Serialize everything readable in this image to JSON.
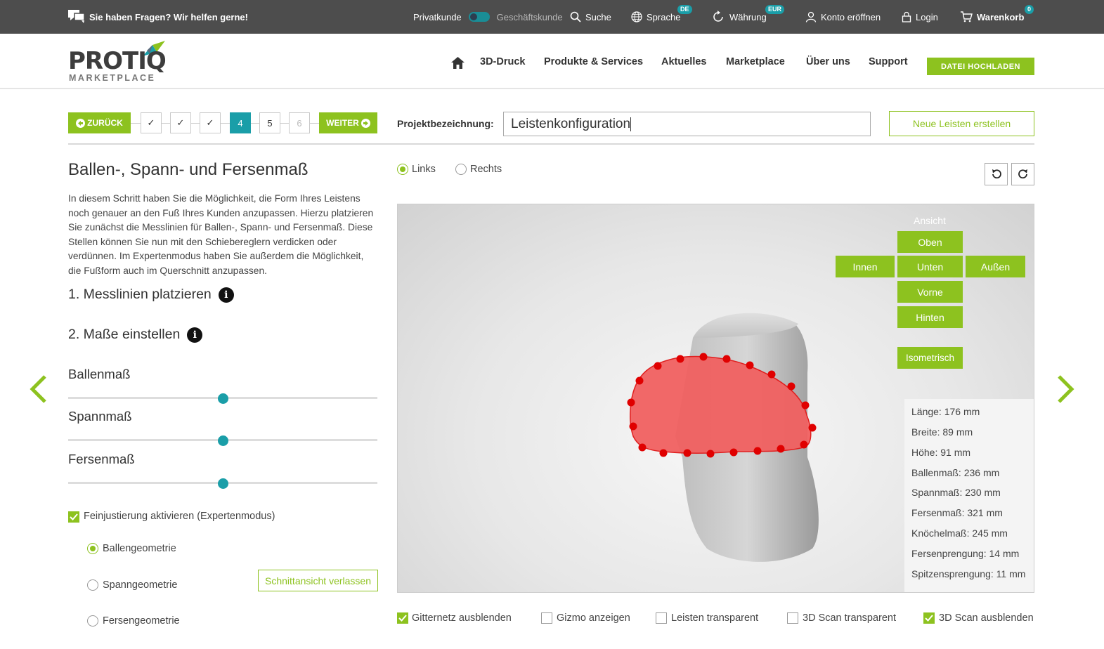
{
  "topbar": {
    "help": "Sie haben Fragen? Wir helfen gerne!",
    "private": "Privatkunde",
    "business": "Geschäftskunde",
    "search": "Suche",
    "language": "Sprache",
    "language_badge": "DE",
    "currency": "Währung",
    "currency_badge": "EUR",
    "register": "Konto eröffnen",
    "login": "Login",
    "cart": "Warenkorb",
    "cart_count": "0"
  },
  "header": {
    "logo_main": "PROTIQ",
    "logo_sub": "MARKETPLACE",
    "nav": [
      "3D-Druck",
      "Produkte & Services",
      "Aktuelles",
      "Marketplace",
      "Über uns",
      "Support"
    ],
    "upload": "DATEI HOCHLADEN"
  },
  "wizard": {
    "back": "ZURÜCK",
    "next": "WEITER",
    "steps": [
      "✓",
      "✓",
      "✓",
      "4",
      "5",
      "6"
    ],
    "project_label": "Projektbezeichnung:",
    "project_value": "Leistenkonfiguration",
    "new_button": "Neue Leisten erstellen"
  },
  "left": {
    "title": "Ballen-, Spann- und Fersenmaß",
    "description": "In diesem Schritt haben Sie die Möglichkeit, die Form Ihres Leistens noch genauer an den Fuß Ihres Kunden anzupassen. Hierzu platzieren Sie zunächst die Messlinien für Ballen-, Spann- und Fersenmaß. Diese Stellen können Sie nun mit den Schiebereglern verdicken oder verdünnen. Im Expertenmodus haben Sie außerdem die Möglichkeit, die Fußform auch im Querschnitt anzupassen.",
    "step1": "1. Messlinien platzieren",
    "step2": "2. Maße einstellen",
    "sliders": [
      {
        "label": "Ballenmaß",
        "value": 0.5
      },
      {
        "label": "Spannmaß",
        "value": 0.5
      },
      {
        "label": "Fersenmaß",
        "value": 0.5
      }
    ],
    "expert_mode": "Feinjustierung aktivieren (Expertenmodus)",
    "geometry_options": [
      "Ballengeometrie",
      "Spanngeometrie",
      "Fersengeometrie"
    ],
    "leave_section": "Schnittansicht verlassen"
  },
  "viewer": {
    "side_links": "Links",
    "side_rechts": "Rechts",
    "view_title": "Ansicht",
    "views": {
      "top": "Oben",
      "inside": "Innen",
      "bottom": "Unten",
      "outside": "Außen",
      "front": "Vorne",
      "back": "Hinten",
      "iso": "Isometrisch"
    },
    "stats": [
      "Länge: 176 mm",
      "Breite: 89 mm",
      "Höhe: 91 mm",
      "Ballenmaß: 236 mm",
      "Spannmaß: 230 mm",
      "Fersenmaß: 321 mm",
      "Knöchelmaß: 245 mm",
      "Fersenprengung: 14 mm",
      "Spitzensprengung: 11 mm"
    ]
  },
  "bottom_options": [
    {
      "label": "Gitternetz ausblenden",
      "checked": true
    },
    {
      "label": "Gizmo anzeigen",
      "checked": false
    },
    {
      "label": "Leisten transparent",
      "checked": false
    },
    {
      "label": "3D Scan transparent",
      "checked": false
    },
    {
      "label": "3D Scan ausblenden",
      "checked": true
    }
  ],
  "colors": {
    "accent": "#8dc21f",
    "teal": "#1a9ea8",
    "topbar": "#4d4d4d",
    "section": "#f06060"
  }
}
